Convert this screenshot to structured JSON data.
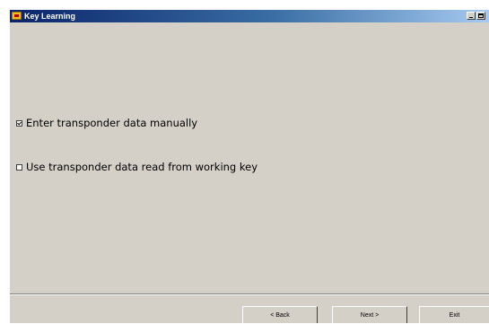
{
  "window": {
    "title": "Key Learning",
    "minimize_label": "_",
    "maximize_label": "□"
  },
  "options": [
    {
      "label": "Enter transponder data manually",
      "checked": true
    },
    {
      "label": "Use transponder data read from working key",
      "checked": false
    }
  ],
  "footer": {
    "back_label": "< Back",
    "next_label": "Next >",
    "exit_label": "Exit"
  },
  "colors": {
    "face": "#d4d0c8",
    "title_start": "#0a246a",
    "title_end": "#a6caf0"
  }
}
